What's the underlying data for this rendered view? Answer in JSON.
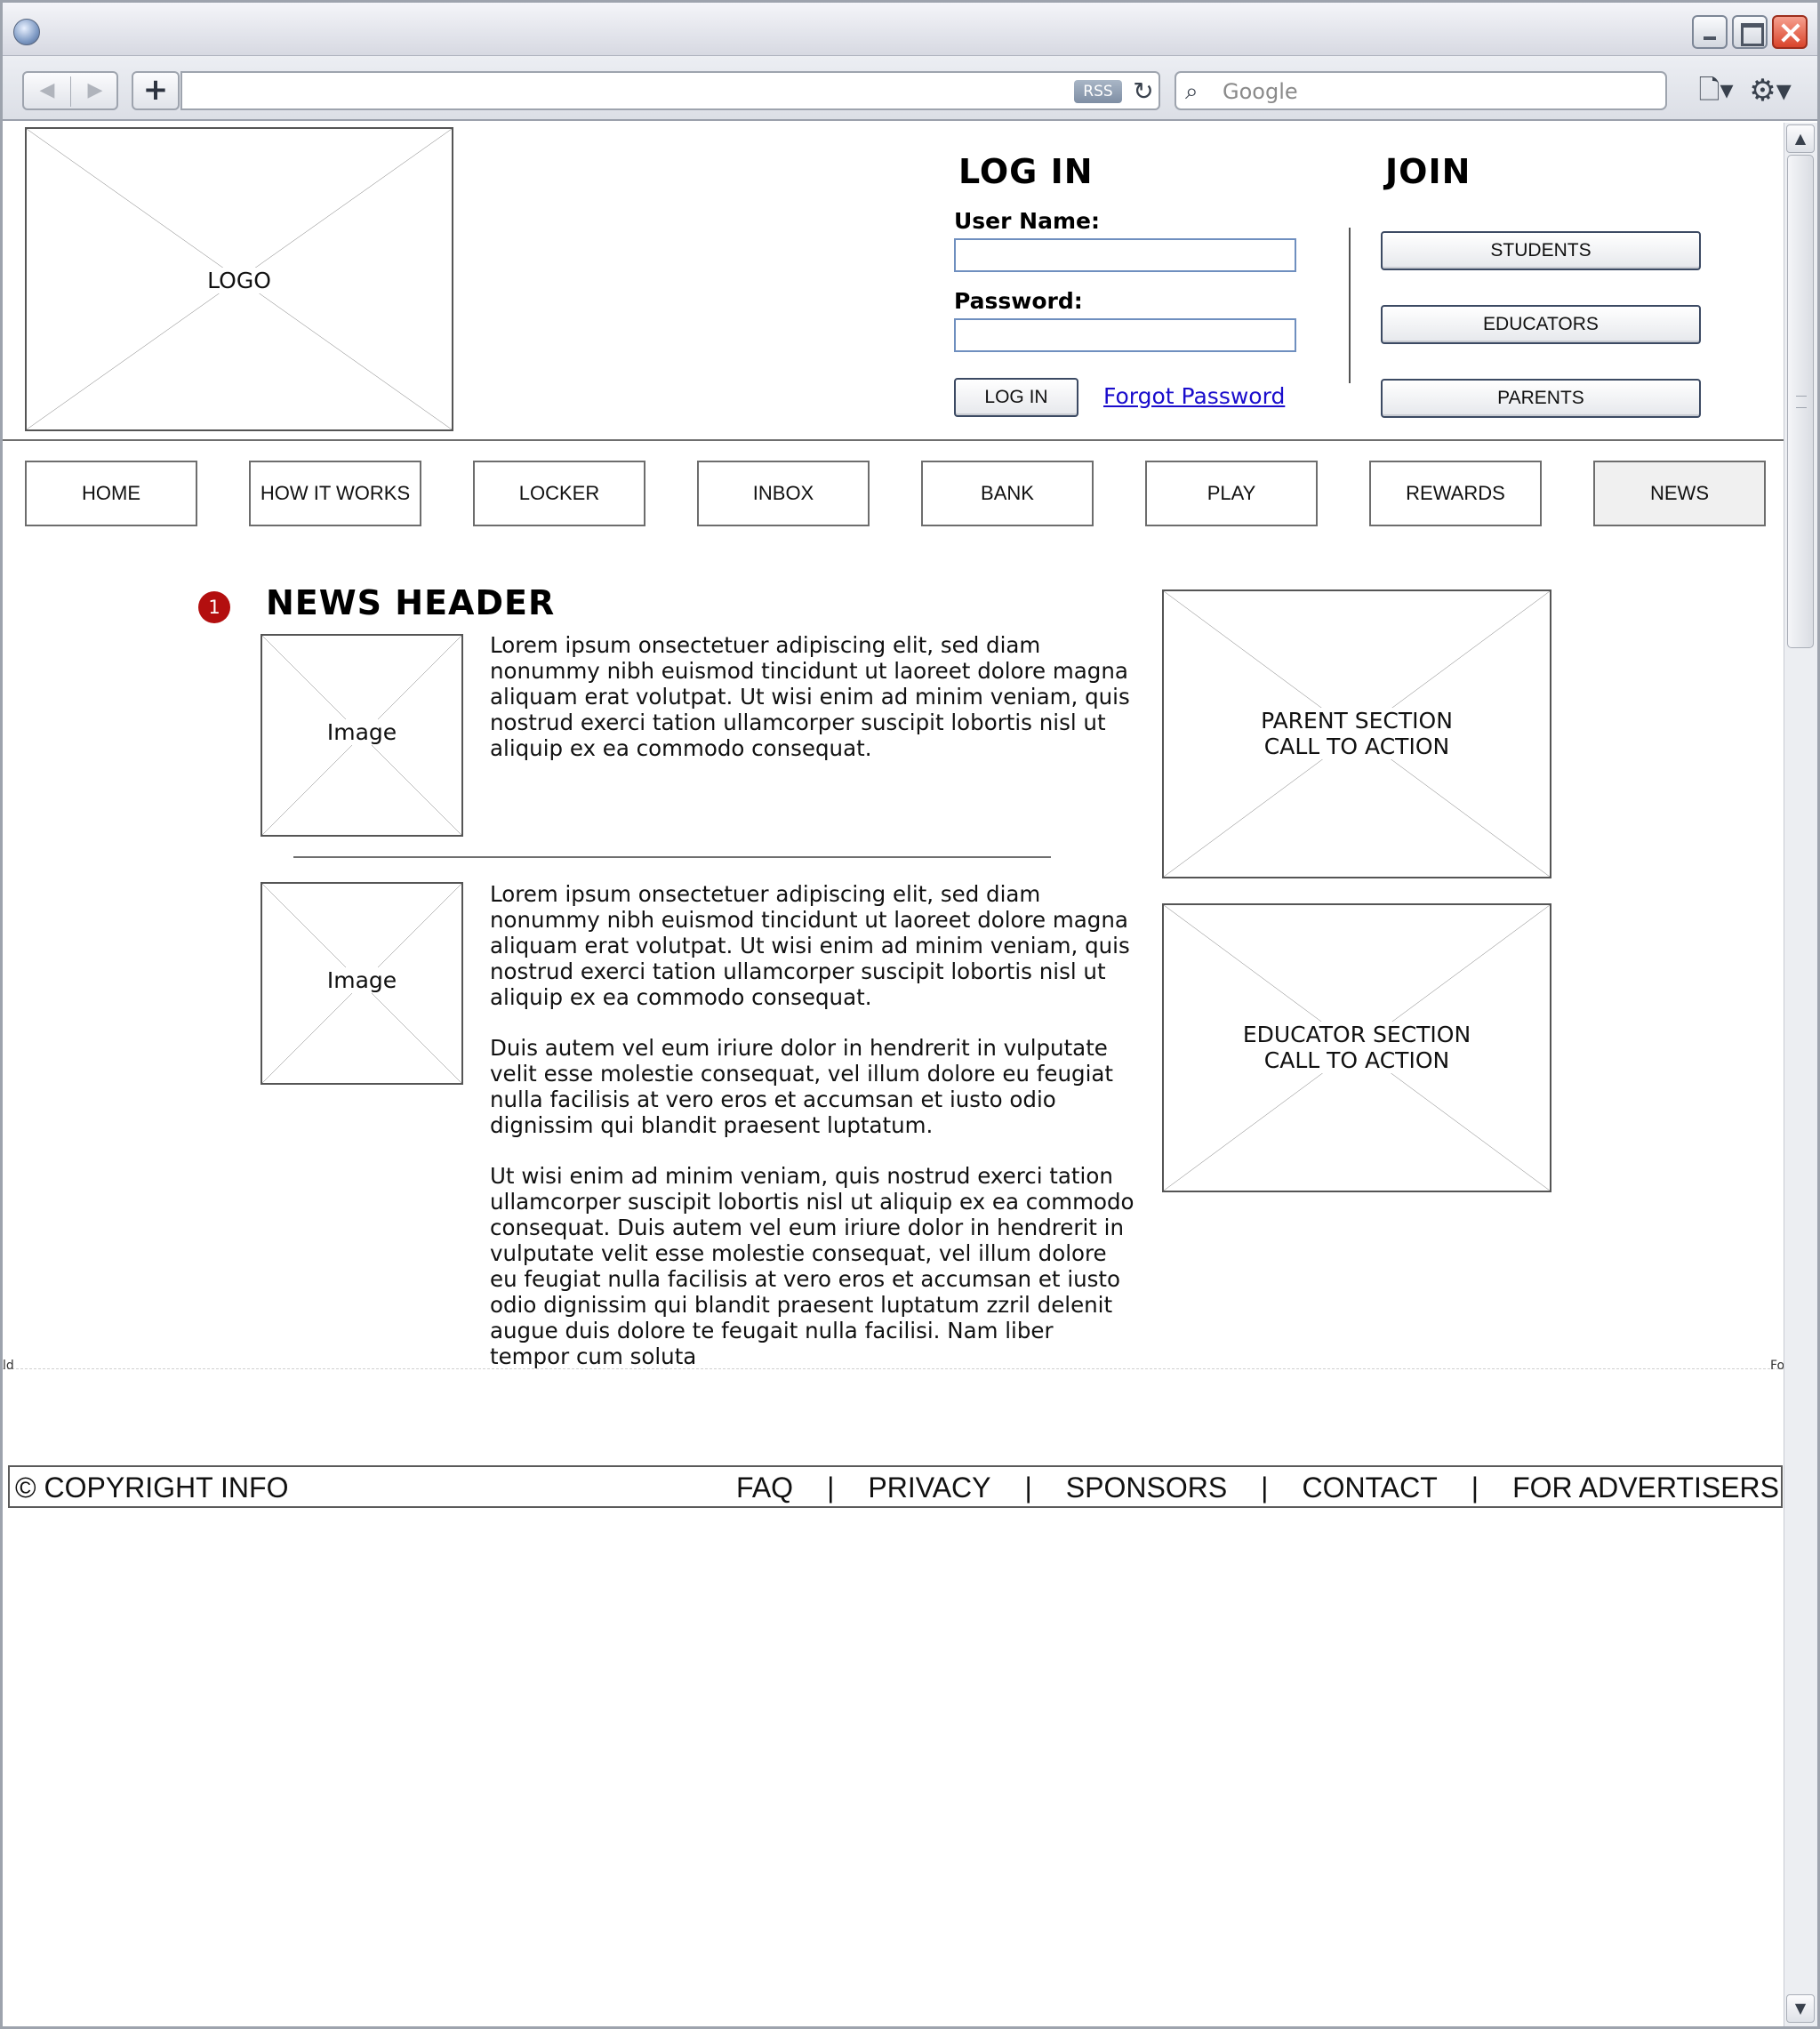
{
  "browser": {
    "rss_label": "RSS",
    "search_placeholder": "Google"
  },
  "header": {
    "logo_label": "LOGO",
    "login": {
      "title": "LOG IN",
      "username_label": "User Name:",
      "username_value": "",
      "password_label": "Password:",
      "password_value": "",
      "button_label": "LOG IN",
      "forgot_label": "Forgot Password"
    },
    "join": {
      "title": "JOIN",
      "buttons": [
        "STUDENTS",
        "EDUCATORS",
        "PARENTS"
      ]
    }
  },
  "nav": {
    "items": [
      "HOME",
      "HOW IT WORKS",
      "LOCKER",
      "INBOX",
      "BANK",
      "PLAY",
      "REWARDS",
      "NEWS"
    ],
    "active": "NEWS"
  },
  "main": {
    "badge": "1",
    "news_header": "NEWS HEADER",
    "image_label": "Image",
    "article1": {
      "text": "Lorem ipsum onsectetuer adipiscing elit, sed diam nonummy nibh euismod tincidunt ut laoreet dolore magna aliquam erat volutpat. Ut wisi enim ad minim veniam, quis nostrud exerci tation ullamcorper suscipit lobortis nisl ut aliquip ex ea commodo consequat."
    },
    "article2": {
      "paragraphs": [
        "Lorem ipsum onsectetuer adipiscing elit, sed diam nonummy nibh euismod tincidunt ut laoreet dolore magna aliquam erat volutpat. Ut wisi enim ad minim veniam, quis nostrud exerci tation ullamcorper suscipit lobortis nisl ut aliquip ex ea commodo consequat.",
        "Duis autem vel eum iriure dolor in hendrerit in vulputate velit esse molestie consequat, vel illum dolore eu feugiat nulla facilisis at vero eros et accumsan et iusto odio dignissim qui blandit praesent luptatum.",
        "Ut wisi enim ad minim veniam, quis nostrud exerci tation ullamcorper suscipit lobortis nisl ut aliquip ex ea commodo consequat. Duis autem vel eum iriure dolor in hendrerit in vulputate velit esse molestie consequat, vel illum dolore eu feugiat nulla facilisis at vero eros et accumsan et iusto odio dignissim qui blandit praesent luptatum zzril delenit augue duis dolore te feugait nulla facilisi. Nam liber tempor cum soluta"
      ]
    },
    "cta_parent": {
      "line1": "PARENT SECTION",
      "line2": "CALL TO ACTION"
    },
    "cta_educator": {
      "line1": "EDUCATOR SECTION",
      "line2": "CALL TO ACTION"
    }
  },
  "fold": {
    "left_label": "ld",
    "right_label": "Fo"
  },
  "footer": {
    "copyright": "© COPYRIGHT INFO",
    "links": [
      "FAQ",
      "PRIVACY",
      "SPONSORS",
      "CONTACT",
      "FOR ADVERTISERS"
    ],
    "separator": "|"
  },
  "icons": {
    "back": "back-arrow-icon",
    "forward": "forward-arrow-icon",
    "new_tab": "plus-icon",
    "reload": "reload-icon",
    "search": "search-icon",
    "page": "page-icon",
    "settings": "gear-icon"
  }
}
